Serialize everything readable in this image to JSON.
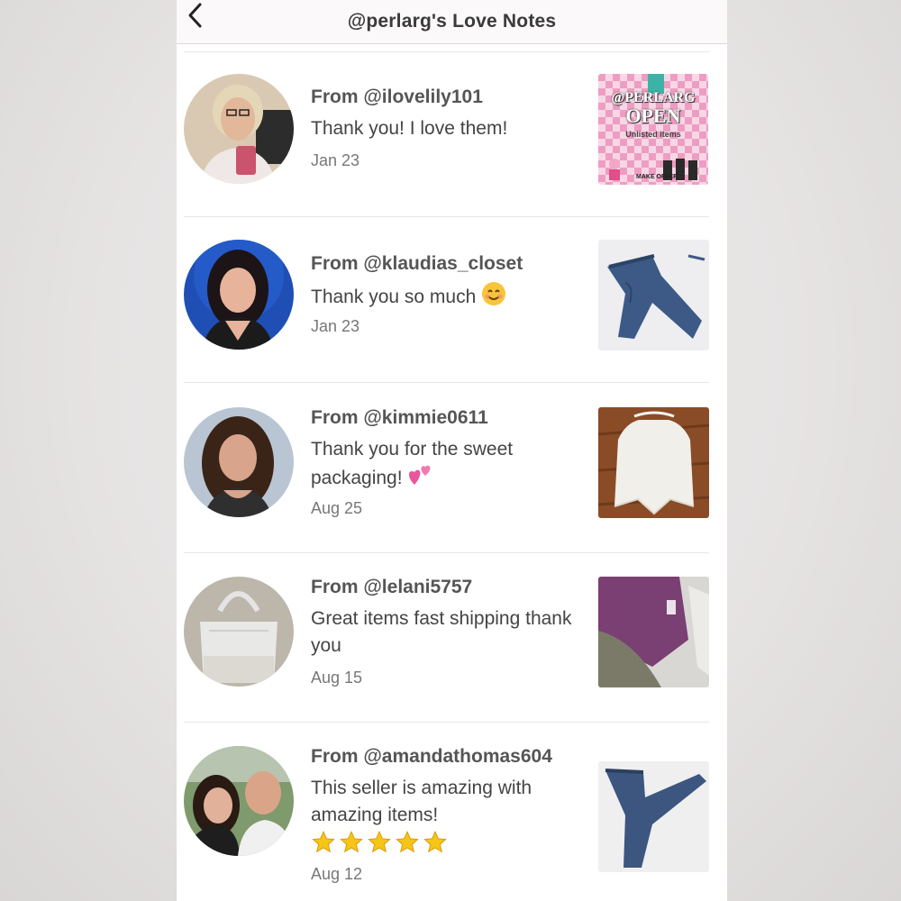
{
  "header": {
    "title": "@perlarg's Love Notes",
    "back_icon": "chevron-left-icon"
  },
  "notes": [
    {
      "from": "From @ilovelily101",
      "message": "Thank you! I love them!",
      "date": "Jan 23",
      "thumb_text": {
        "line1": "@PERLARG",
        "line2": "OPEN",
        "line3": "Unlisted items",
        "line4": "MAKE OFFER"
      }
    },
    {
      "from": "From @klaudias_closet",
      "message": "Thank you so much",
      "emoji": "smiling-face-icon",
      "date": "Jan 23"
    },
    {
      "from": "From @kimmie0611",
      "message": "Thank you for the sweet packaging!",
      "emoji": "two-hearts-icon",
      "date": "Aug 25"
    },
    {
      "from": "From @lelani5757",
      "message": "Great items fast shipping thank you",
      "date": "Aug 15"
    },
    {
      "from": "From @amandathomas604",
      "message": "This seller is amazing with amazing items!",
      "emoji": "star-icon",
      "stars": 5,
      "date": "Aug 12"
    }
  ],
  "colors": {
    "accent_pink": "#e8569b",
    "star": "#f5c518",
    "text": "#444444"
  }
}
